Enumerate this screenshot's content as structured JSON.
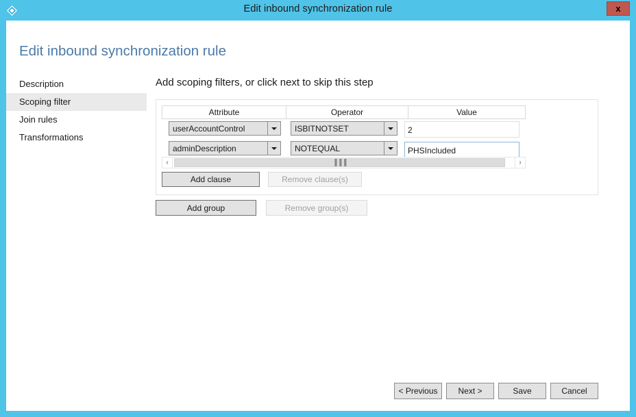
{
  "window": {
    "title": "Edit inbound synchronization rule",
    "icon": "diamond-icon",
    "close_label": "x",
    "border_color": "#4fc3e8"
  },
  "page": {
    "title": "Edit inbound synchronization rule",
    "title_color": "#4a7aa8"
  },
  "sidebar": {
    "items": [
      {
        "label": "Description",
        "selected": false
      },
      {
        "label": "Scoping filter",
        "selected": true
      },
      {
        "label": "Join rules",
        "selected": false
      },
      {
        "label": "Transformations",
        "selected": false
      }
    ]
  },
  "main": {
    "heading": "Add scoping filters, or click next to skip this step",
    "table": {
      "columns": [
        "Attribute",
        "Operator",
        "Value"
      ],
      "rows": [
        {
          "attribute": "userAccountControl",
          "operator": "ISBITNOTSET",
          "value": "2",
          "value_focused": false
        },
        {
          "attribute": "adminDescription",
          "operator": "NOTEQUAL",
          "value": "PHSIncluded",
          "value_focused": true
        }
      ]
    },
    "scrollbar": {
      "left_arrow": "‹",
      "right_arrow": "›",
      "grip": "▐▐▐"
    },
    "clause_buttons": {
      "add": "Add clause",
      "remove": "Remove clause(s)",
      "remove_enabled": false
    },
    "group_buttons": {
      "add": "Add group",
      "remove": "Remove group(s)",
      "remove_enabled": false
    }
  },
  "footer": {
    "previous": "< Previous",
    "next": "Next >",
    "save": "Save",
    "cancel": "Cancel"
  }
}
